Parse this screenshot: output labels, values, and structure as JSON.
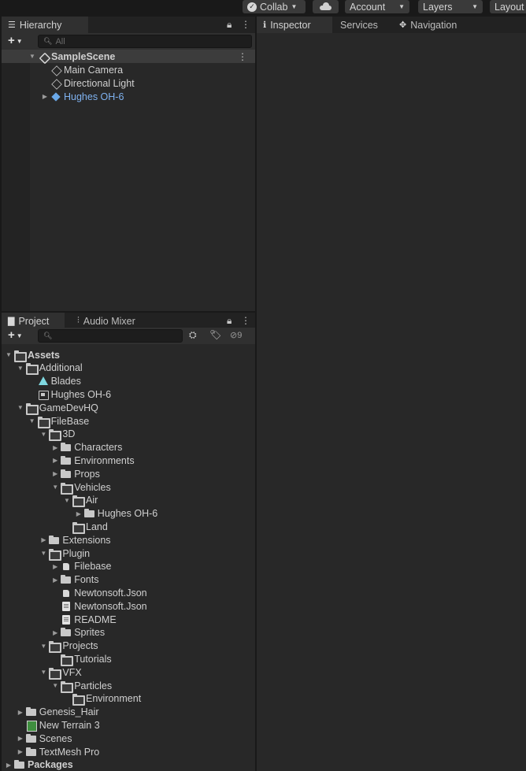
{
  "toolbar": {
    "collab_label": "Collab",
    "account_label": "Account",
    "layers_label": "Layers",
    "layout_label": "Layout"
  },
  "hierarchy": {
    "tab_label": "Hierarchy",
    "search_placeholder": "All",
    "scene_name": "SampleScene",
    "items": [
      {
        "label": "Main Camera"
      },
      {
        "label": "Directional Light"
      },
      {
        "label": "Hughes OH-6",
        "color": "#7fb2f0"
      }
    ]
  },
  "inspector": {
    "tabs": [
      "Inspector",
      "Services",
      "Navigation"
    ]
  },
  "project": {
    "tabs": [
      "Project",
      "Audio Mixer"
    ],
    "badge_count": "9",
    "tree": [
      {
        "label": "Assets"
      },
      {
        "label": "Additional"
      },
      {
        "label": "Blades"
      },
      {
        "label": "Hughes OH-6"
      },
      {
        "label": "GameDevHQ"
      },
      {
        "label": "FileBase"
      },
      {
        "label": "3D"
      },
      {
        "label": "Characters"
      },
      {
        "label": "Environments"
      },
      {
        "label": "Props"
      },
      {
        "label": "Vehicles"
      },
      {
        "label": "Air"
      },
      {
        "label": "Hughes OH-6"
      },
      {
        "label": "Land"
      },
      {
        "label": "Extensions"
      },
      {
        "label": "Plugin"
      },
      {
        "label": "Filebase"
      },
      {
        "label": "Fonts"
      },
      {
        "label": "Newtonsoft.Json"
      },
      {
        "label": "Newtonsoft.Json"
      },
      {
        "label": "README"
      },
      {
        "label": "Sprites"
      },
      {
        "label": "Projects"
      },
      {
        "label": "Tutorials"
      },
      {
        "label": "VFX"
      },
      {
        "label": "Particles"
      },
      {
        "label": "Environment"
      },
      {
        "label": "Genesis_Hair"
      },
      {
        "label": "New Terrain 3"
      },
      {
        "label": "Scenes"
      },
      {
        "label": "TextMesh Pro"
      },
      {
        "label": "Packages"
      }
    ]
  }
}
